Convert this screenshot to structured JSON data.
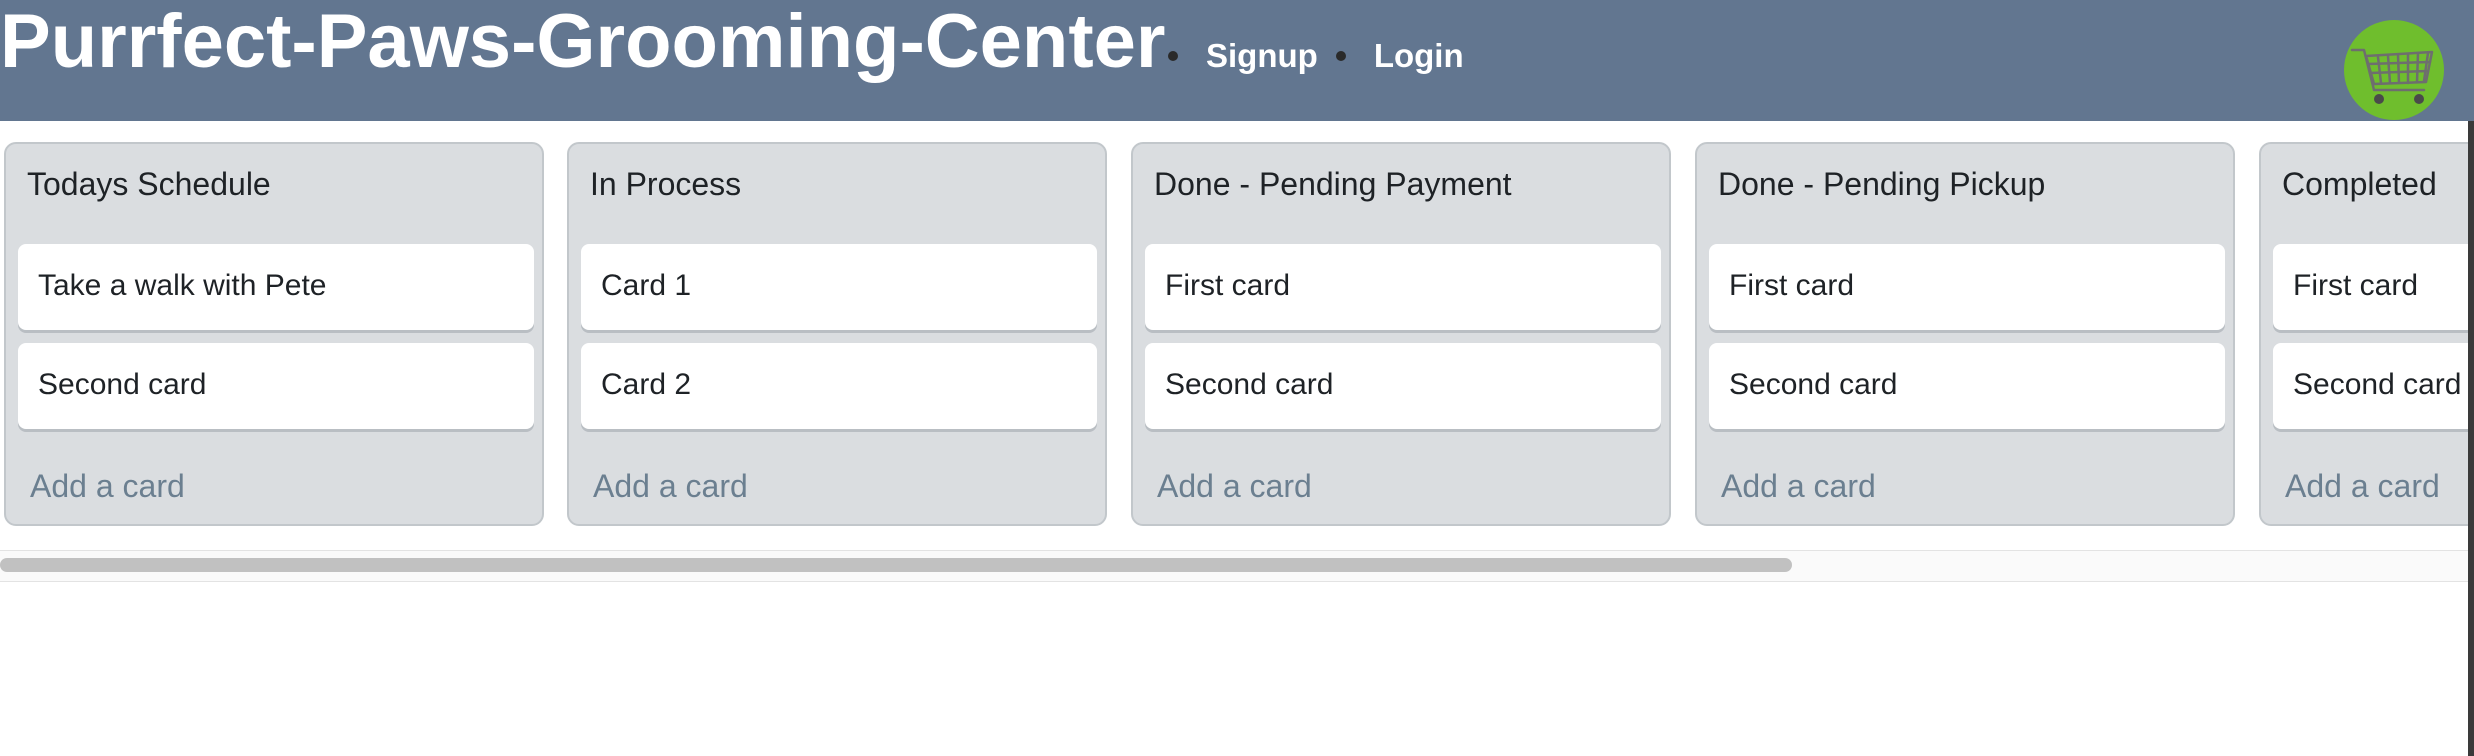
{
  "header": {
    "site_title": "Purrfect-Paws-Grooming-Center",
    "nav": [
      {
        "label": "Signup"
      },
      {
        "label": "Login"
      }
    ],
    "cart_icon": "shopping-cart-icon",
    "colors": {
      "header_bg": "#627690",
      "cart_bg": "#6fbe2d"
    }
  },
  "board": {
    "lists": [
      {
        "title": "Todays Schedule",
        "cards": [
          "Take a walk with Pete",
          "Second card"
        ],
        "add_label": "Add a card"
      },
      {
        "title": "In Process",
        "cards": [
          "Card 1",
          "Card 2"
        ],
        "add_label": "Add a card"
      },
      {
        "title": "Done - Pending Payment",
        "cards": [
          "First card",
          "Second card"
        ],
        "add_label": "Add a card"
      },
      {
        "title": "Done - Pending Pickup",
        "cards": [
          "First card",
          "Second card"
        ],
        "add_label": "Add a card"
      },
      {
        "title": "Completed",
        "cards": [
          "First card",
          "Second card"
        ],
        "add_label": "Add a card"
      }
    ]
  }
}
